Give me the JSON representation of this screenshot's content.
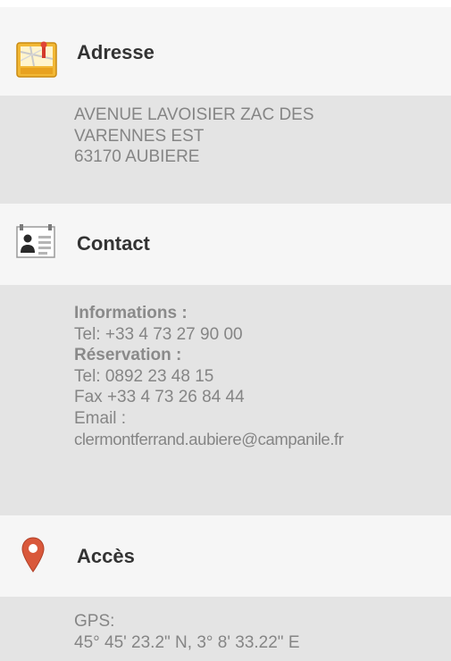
{
  "sections": {
    "address": {
      "title": "Adresse",
      "icon": "address-map-icon",
      "lines": [
        "AVENUE LAVOISIER ZAC DES",
        "VARENNES EST",
        "63170 AUBIERE"
      ]
    },
    "contact": {
      "title": "Contact",
      "icon": "contact-card-icon",
      "info_label": "Informations :",
      "info_tel": "Tel: +33 4 73 27 90 00",
      "reservation_label": "Réservation :",
      "reservation_tel": "Tel: 0892 23 48 15",
      "fax": "Fax +33 4 73 26 84 44",
      "email_label": "Email :",
      "email": "clermontferrand.aubiere@campanile.fr"
    },
    "access": {
      "title": "Accès",
      "icon": "map-pin-icon",
      "gps_label": "GPS:",
      "gps_coords": "45° 45' 23.2\" N, 3° 8' 33.22\" E"
    }
  },
  "colors": {
    "header_bg": "#f6f6f6",
    "body_bg": "#e4e4e4",
    "title_text": "#333333",
    "body_text": "#858585",
    "pin_red": "#d9583b",
    "map_yellow": "#f2b835"
  }
}
